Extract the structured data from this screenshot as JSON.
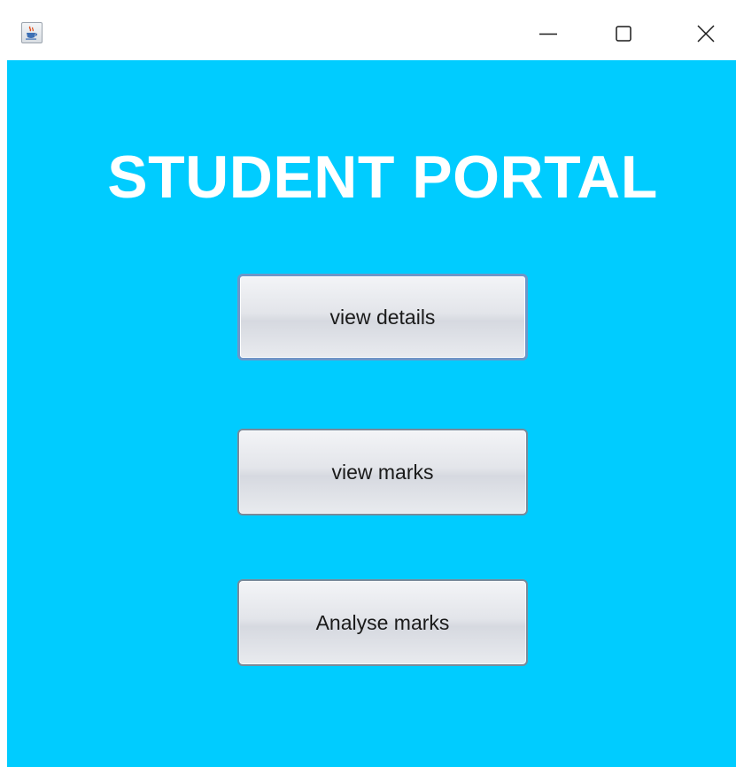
{
  "window": {
    "app_icon": "java-coffee-cup-icon",
    "controls": {
      "minimize_icon": "minimize-icon",
      "maximize_icon": "maximize-icon",
      "close_icon": "close-icon"
    }
  },
  "main": {
    "title": "STUDENT PORTAL",
    "buttons": {
      "view_details": "view details",
      "view_marks": "view marks",
      "analyse_marks": "Analyse marks"
    }
  },
  "colors": {
    "background": "#00ccff",
    "title_text": "#ffffff",
    "button_border": "#7a8a9a",
    "focus_border": "#6e96c8"
  }
}
